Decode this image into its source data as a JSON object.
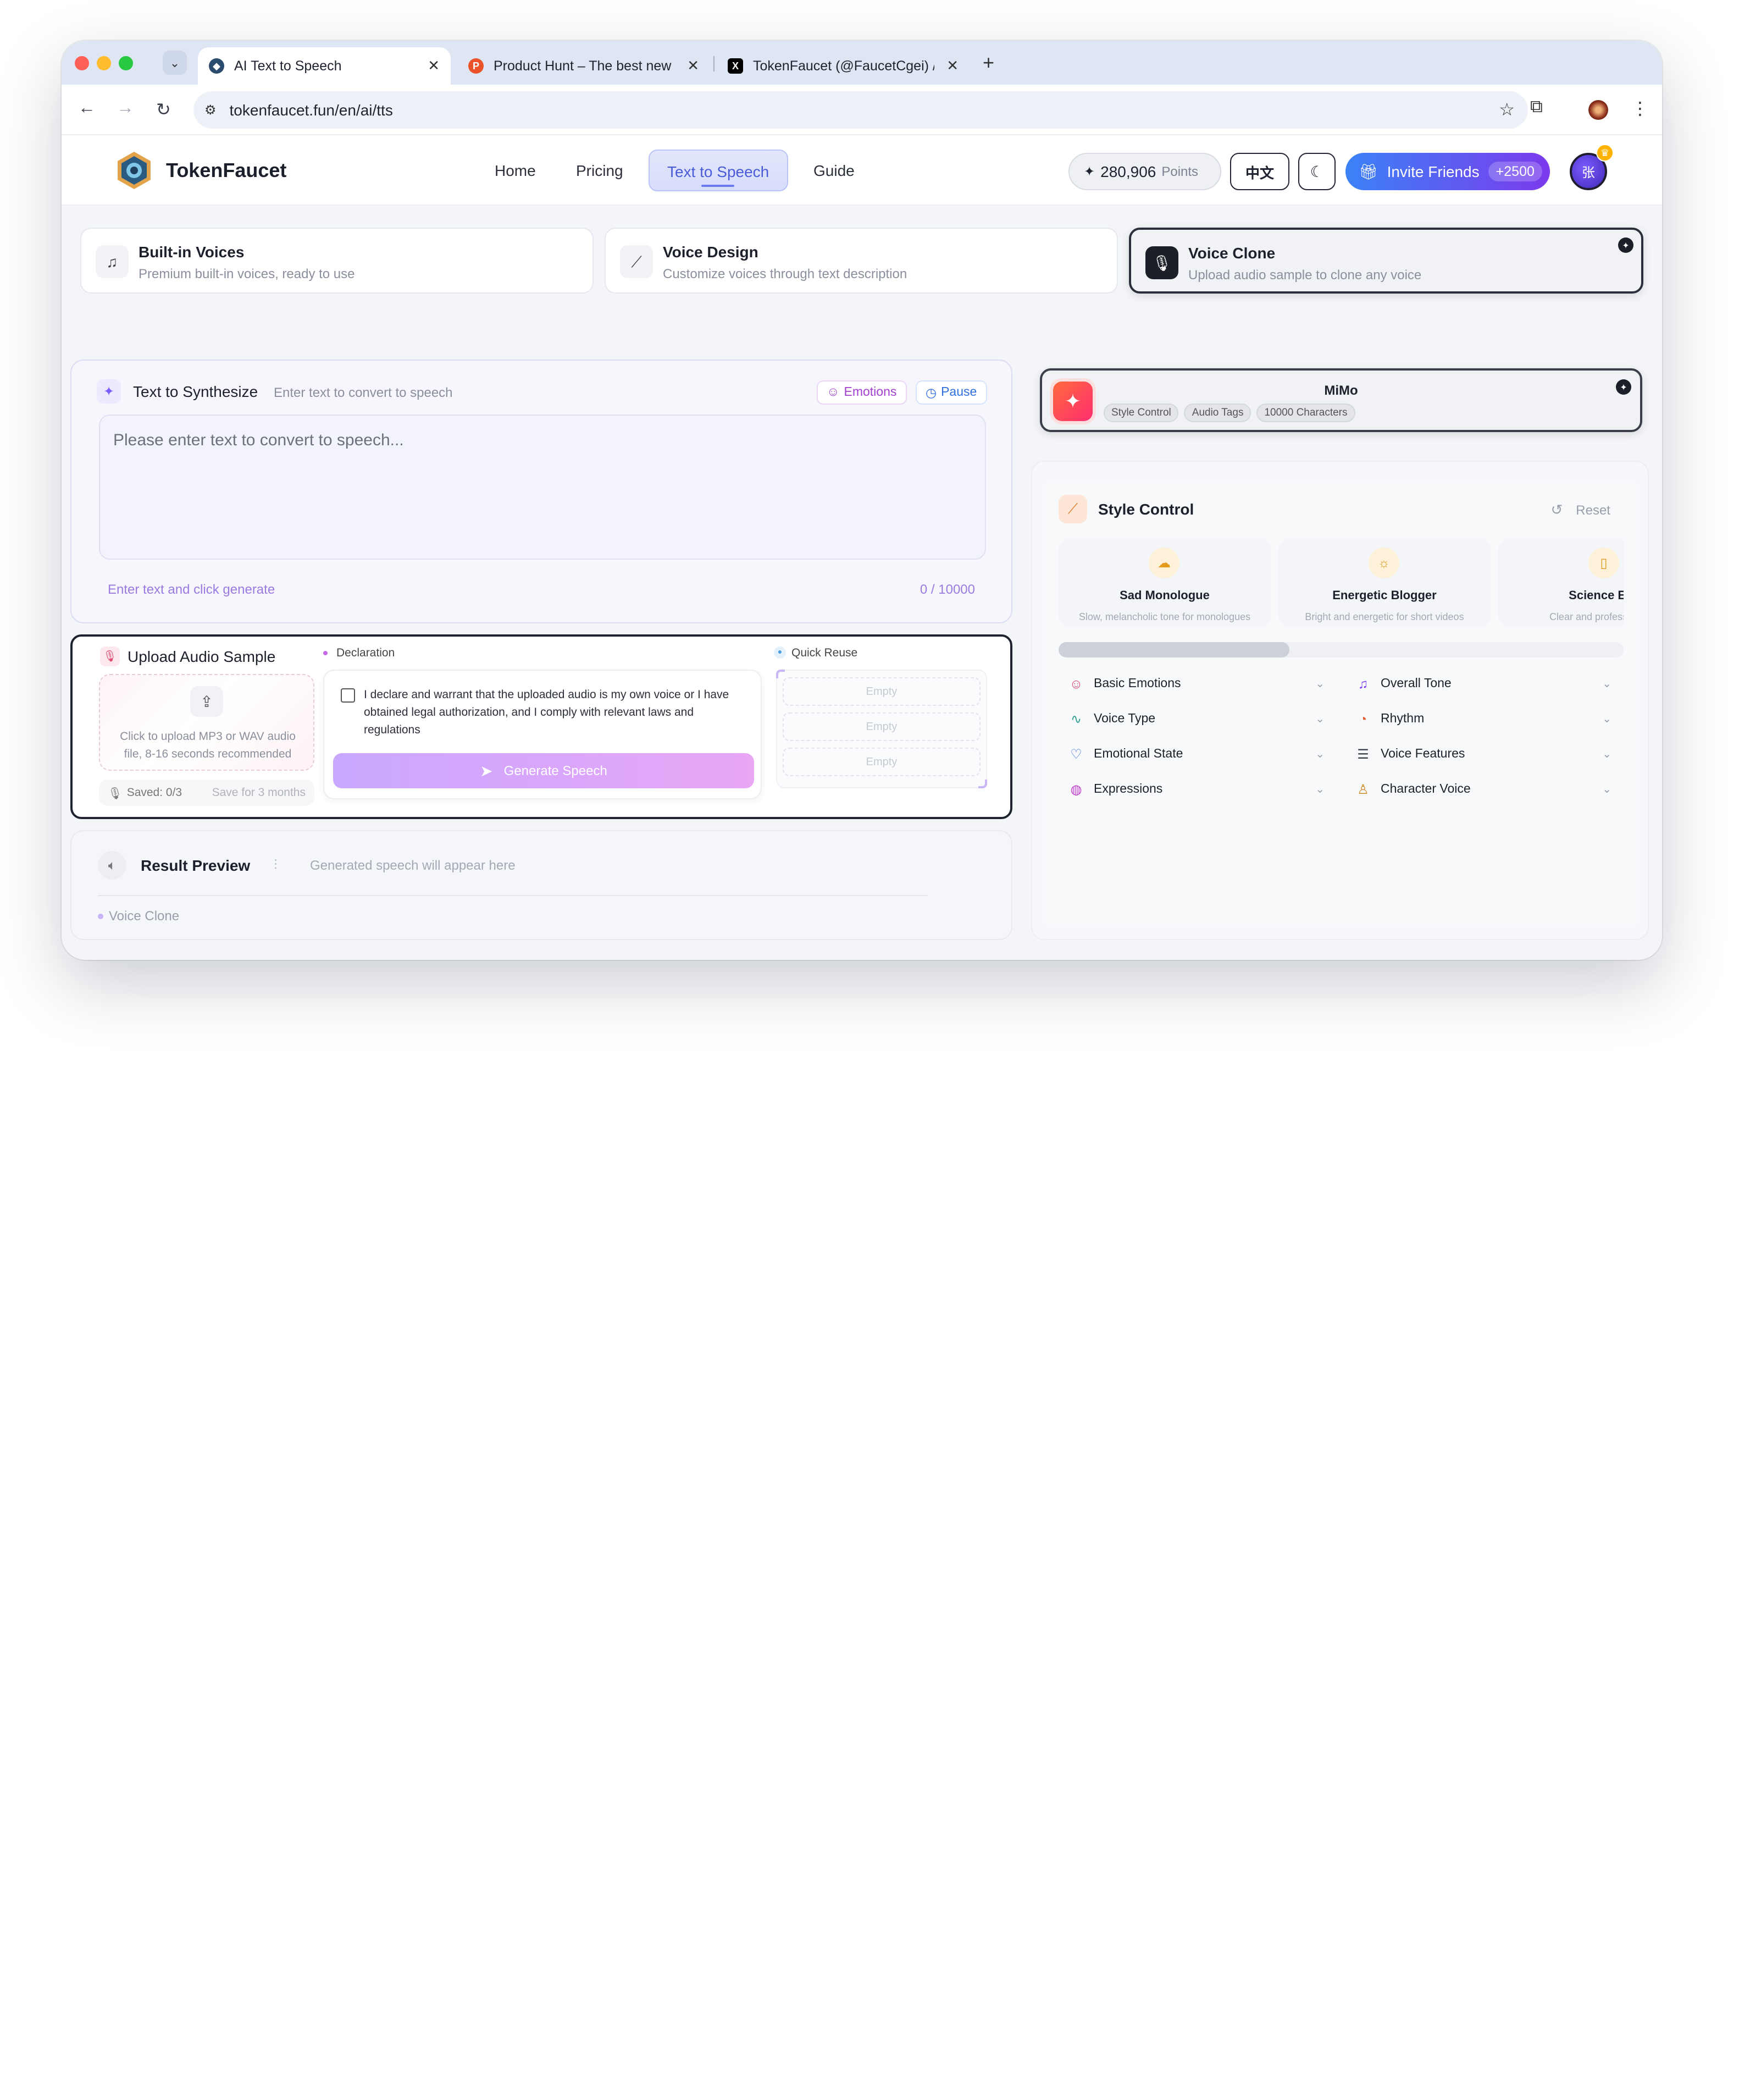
{
  "browser": {
    "tabs": [
      {
        "title": "AI Text to Speech",
        "icon": "tokenfaucet-favicon",
        "active": true
      },
      {
        "title": "Product Hunt – The best new",
        "icon": "product-hunt-favicon",
        "active": false
      },
      {
        "title": "TokenFaucet (@FaucetCgei) /",
        "icon": "x-favicon",
        "active": false
      }
    ],
    "url": "tokenfaucet.fun/en/ai/tts"
  },
  "header": {
    "brand": "TokenFaucet",
    "nav": [
      "Home",
      "Pricing",
      "Text to Speech",
      "Guide"
    ],
    "active_nav": "Text to Speech",
    "points_value": "280,906",
    "points_unit": "Points",
    "lang_label": "中文",
    "invite_label": "Invite Friends",
    "invite_bonus": "+2500",
    "avatar_initial": "张"
  },
  "modes": [
    {
      "title": "Built-in Voices",
      "subtitle": "Premium built-in voices, ready to use",
      "icon": "music-note-icon"
    },
    {
      "title": "Voice Design",
      "subtitle": "Customize voices through text description",
      "icon": "magic-wand-icon"
    },
    {
      "title": "Voice Clone",
      "subtitle": "Upload audio sample to clone any voice",
      "icon": "microphone-icon",
      "active": true
    }
  ],
  "synth": {
    "title": "Text to Synthesize",
    "hint": "Enter text to convert to speech",
    "emotions_label": "Emotions",
    "pause_label": "Pause",
    "placeholder": "Please enter text to convert to speech...",
    "footer_hint": "Enter text and click generate",
    "counter": "0 / 10000"
  },
  "upload": {
    "title": "Upload Audio Sample",
    "drop_text": "Click to upload MP3 or WAV audio file, 8-16 seconds recommended",
    "saved": "Saved: 0/3",
    "save_period": "Save for 3 months",
    "declaration_heading": "Declaration",
    "declaration_text": "I declare and warrant that the uploaded audio is my own voice or I have obtained legal authorization, and I comply with relevant laws and regulations",
    "generate_label": "Generate Speech",
    "quick_reuse_heading": "Quick Reuse",
    "slots": [
      "Empty",
      "Empty",
      "Empty"
    ]
  },
  "result": {
    "title": "Result Preview",
    "hint": "Generated speech will appear here",
    "tag": "Voice Clone"
  },
  "model": {
    "name": "MiMo",
    "tags": [
      "Style Control",
      "Audio Tags",
      "10000 Characters"
    ]
  },
  "style": {
    "title": "Style Control",
    "reset_label": "Reset",
    "presets": [
      {
        "name": "Sad Monologue",
        "desc": "Slow, melancholic tone for monologues",
        "icon": "cloud-rain-icon"
      },
      {
        "name": "Energetic Blogger",
        "desc": "Bright and energetic for short videos",
        "icon": "sun-icon"
      },
      {
        "name": "Science Exp",
        "desc": "Clear and professional fo",
        "icon": "book-icon"
      }
    ],
    "categories_left": [
      {
        "label": "Basic Emotions",
        "icon": "smile-icon",
        "color": "#e0466e"
      },
      {
        "label": "Voice Type",
        "icon": "waveform-icon",
        "color": "#2f9e8f"
      },
      {
        "label": "Emotional State",
        "icon": "heart-icon",
        "color": "#3b6fe0"
      },
      {
        "label": "Expressions",
        "icon": "palette-icon",
        "color": "#c43bd0"
      }
    ],
    "categories_right": [
      {
        "label": "Overall Tone",
        "icon": "music-icon",
        "color": "#7c3aed"
      },
      {
        "label": "Rhythm",
        "icon": "timer-icon",
        "color": "#e2552d"
      },
      {
        "label": "Voice Features",
        "icon": "sliders-icon",
        "color": "#3b3f4a"
      },
      {
        "label": "Character Voice",
        "icon": "user-icon",
        "color": "#d08a1f"
      }
    ]
  },
  "colors": {
    "accent": "#4a5bd8",
    "invite_gradient_start": "#3b82f6",
    "invite_gradient_end": "#7c3aed",
    "generate_gradient_start": "#c9a7ff",
    "generate_gradient_end": "#e8a6f5"
  }
}
